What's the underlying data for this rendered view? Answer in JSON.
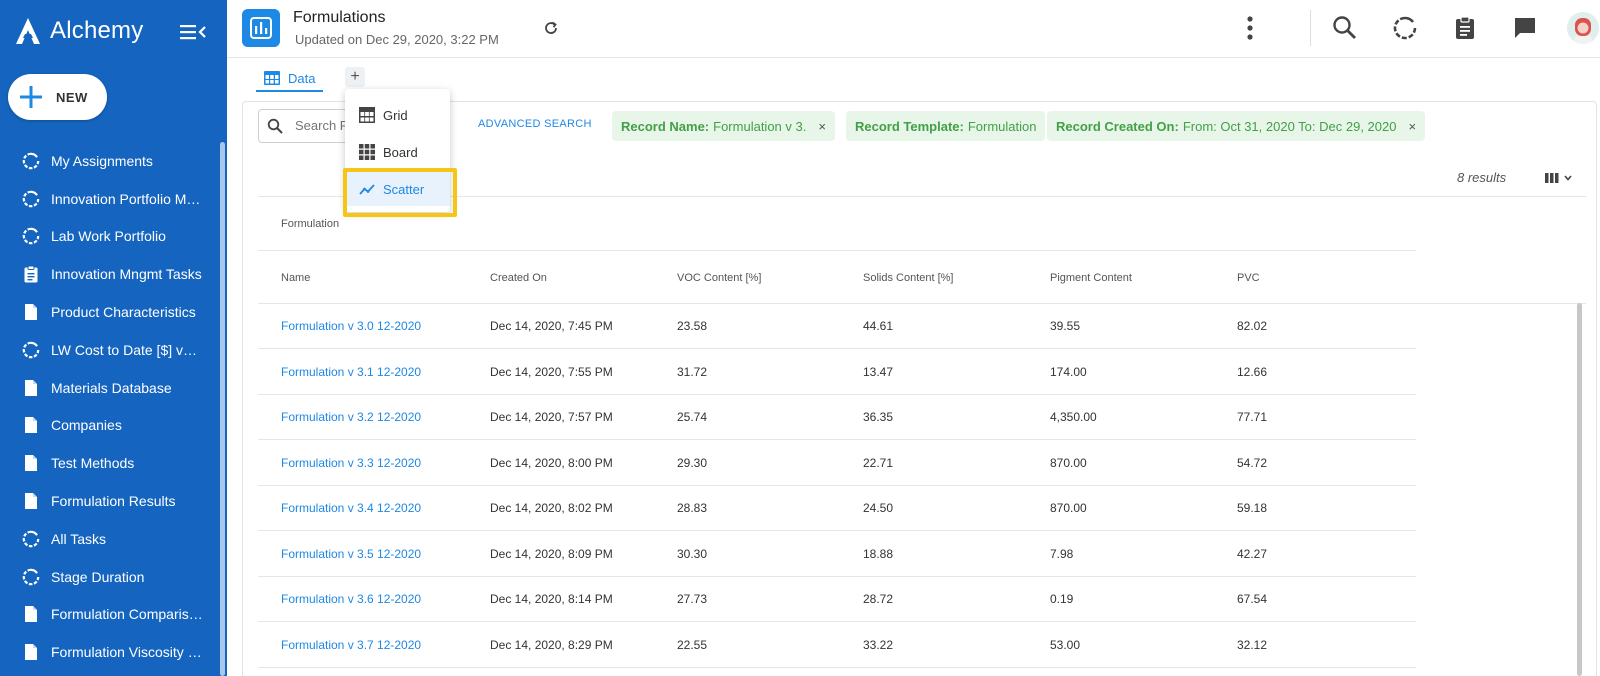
{
  "app": {
    "name": "Alchemy"
  },
  "sidebar": {
    "new_label": "NEW",
    "items": [
      {
        "label": "My Assignments",
        "icon": "progress-circle-icon"
      },
      {
        "label": "Innovation Portfolio Ma...",
        "icon": "progress-circle-icon"
      },
      {
        "label": "Lab Work Portfolio",
        "icon": "progress-circle-icon"
      },
      {
        "label": "Innovation Mngmt Tasks",
        "icon": "clipboard-icon"
      },
      {
        "label": "Product Characteristics",
        "icon": "document-icon"
      },
      {
        "label": "LW Cost to Date [$] vs E...",
        "icon": "progress-circle-icon"
      },
      {
        "label": "Materials Database",
        "icon": "document-icon"
      },
      {
        "label": "Companies",
        "icon": "document-icon"
      },
      {
        "label": "Test Methods",
        "icon": "document-icon"
      },
      {
        "label": "Formulation Results",
        "icon": "document-icon"
      },
      {
        "label": "All Tasks",
        "icon": "progress-circle-icon"
      },
      {
        "label": "Stage Duration",
        "icon": "progress-circle-icon"
      },
      {
        "label": "Formulation Comparison",
        "icon": "document-icon"
      },
      {
        "label": "Formulation Viscosity C...",
        "icon": "document-icon"
      }
    ]
  },
  "header": {
    "title": "Formulations",
    "updated": "Updated on Dec 29, 2020, 3:22 PM"
  },
  "tabs": {
    "data_label": "Data",
    "add_label": "+"
  },
  "dropdown": {
    "items": [
      {
        "label": "Grid",
        "icon": "grid-icon"
      },
      {
        "label": "Board",
        "icon": "board-icon"
      },
      {
        "label": "Scatter",
        "icon": "scatter-chart-icon"
      }
    ]
  },
  "search": {
    "placeholder": "Search F",
    "advanced_label": "ADVANCED SEARCH"
  },
  "filters": [
    {
      "key": "Record Name:",
      "value": "Formulation v 3.",
      "x": "×"
    },
    {
      "key": "Record Template:",
      "value": "Formulation"
    },
    {
      "key": "Record Created On:",
      "value": "From: Oct 31, 2020 To: Dec 29, 2020",
      "x": "×"
    }
  ],
  "results_label": "8 results",
  "table": {
    "group_header": "Formulation",
    "columns": [
      "Name",
      "Created On",
      "VOC Content [%]",
      "Solids Content [%]",
      "Pigment Content",
      "PVC"
    ],
    "rows": [
      [
        "Formulation v 3.0 12-2020",
        "Dec 14, 2020, 7:45 PM",
        "23.58",
        "44.61",
        "39.55",
        "82.02"
      ],
      [
        "Formulation v 3.1 12-2020",
        "Dec 14, 2020, 7:55 PM",
        "31.72",
        "13.47",
        "174.00",
        "12.66"
      ],
      [
        "Formulation v 3.2 12-2020",
        "Dec 14, 2020, 7:57 PM",
        "25.74",
        "36.35",
        "4,350.00",
        "77.71"
      ],
      [
        "Formulation v 3.3 12-2020",
        "Dec 14, 2020, 8:00 PM",
        "29.30",
        "22.71",
        "870.00",
        "54.72"
      ],
      [
        "Formulation v 3.4 12-2020",
        "Dec 14, 2020, 8:02 PM",
        "28.83",
        "24.50",
        "870.00",
        "59.18"
      ],
      [
        "Formulation v 3.5 12-2020",
        "Dec 14, 2020, 8:09 PM",
        "30.30",
        "18.88",
        "7.98",
        "42.27"
      ],
      [
        "Formulation v 3.6 12-2020",
        "Dec 14, 2020, 8:14 PM",
        "27.73",
        "28.72",
        "0.19",
        "67.54"
      ],
      [
        "Formulation v 3.7 12-2020",
        "Dec 14, 2020, 8:29 PM",
        "22.55",
        "33.22",
        "53.00",
        "32.12"
      ]
    ]
  },
  "colors": {
    "sidebar": "#1565c0",
    "accent": "#1e88e5",
    "chip_bg": "#e8f5e9",
    "chip_text": "#43a047",
    "highlight": "#f5c518"
  }
}
